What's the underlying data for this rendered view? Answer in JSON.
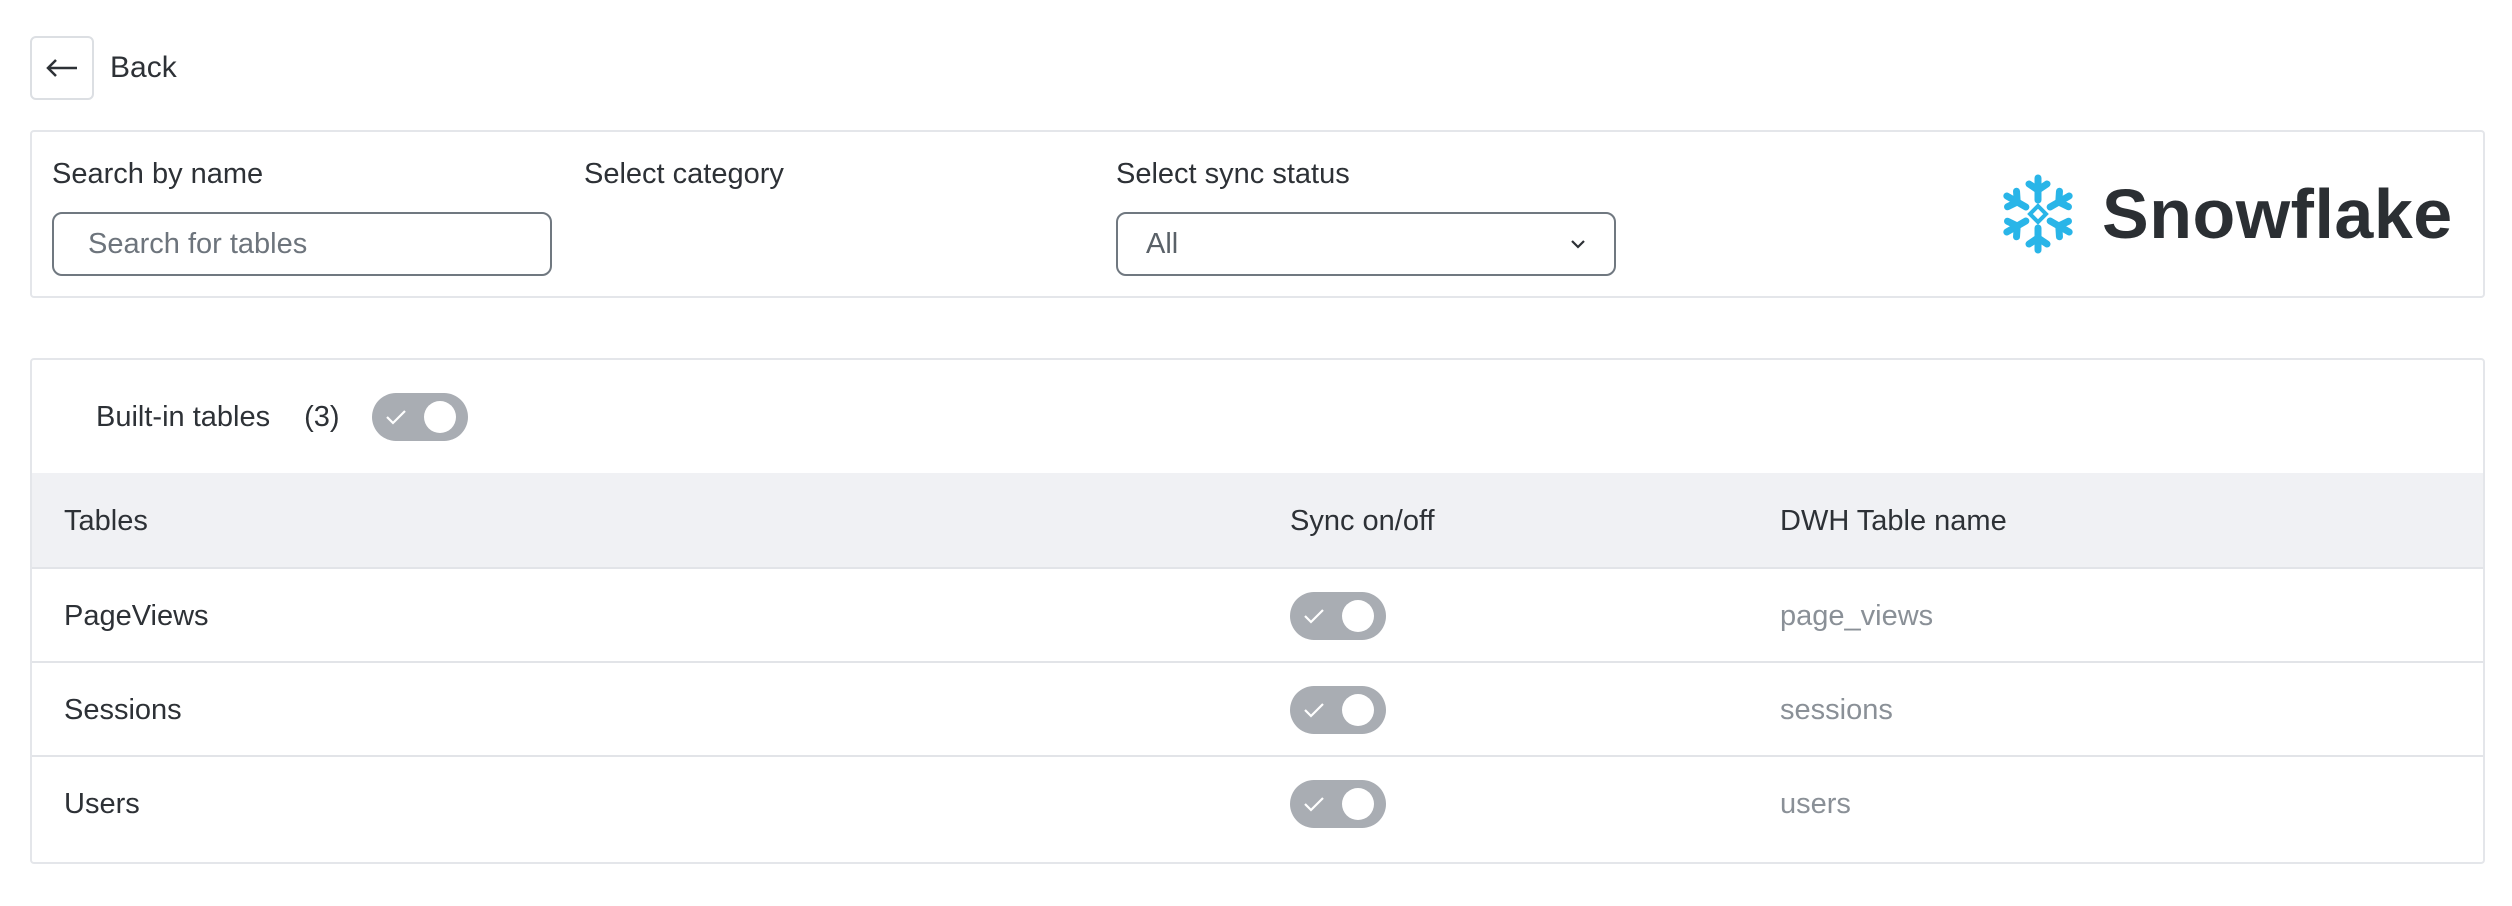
{
  "back": {
    "label": "Back",
    "icon": "arrow-left-icon"
  },
  "filters": {
    "search_label": "Search by name",
    "search_placeholder": "Search for tables",
    "search_value": "",
    "category_label": "Select category",
    "status_label": "Select sync status",
    "status_value": "All"
  },
  "brand": {
    "name": "Snowflake",
    "icon": "snowflake-icon",
    "color": "#29b5e8"
  },
  "group": {
    "title": "Built-in tables",
    "count": "(3)",
    "enabled": true
  },
  "table": {
    "headers": {
      "tables": "Tables",
      "sync": "Sync on/off",
      "dwh": "DWH Table name"
    },
    "rows": [
      {
        "name": "PageViews",
        "sync": true,
        "dwh": "page_views"
      },
      {
        "name": "Sessions",
        "sync": true,
        "dwh": "sessions"
      },
      {
        "name": "Users",
        "sync": true,
        "dwh": "users"
      }
    ]
  },
  "colors": {
    "toggle_bg": "#a9adb3",
    "header_bg": "#f0f1f4",
    "muted_text": "#8a9097"
  }
}
